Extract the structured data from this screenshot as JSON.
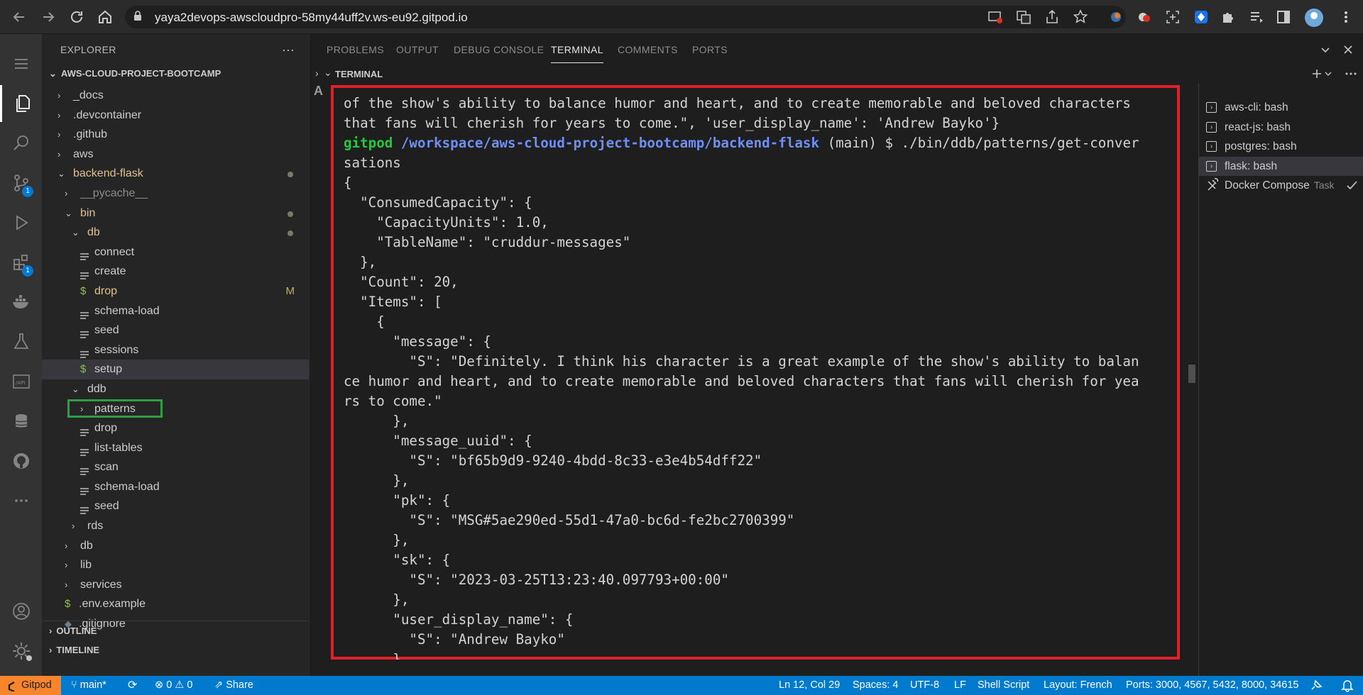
{
  "browser": {
    "url": "yaya2devops-awscloudpro-58my44uff2v.ws-eu92.gitpod.io"
  },
  "activity_bar": {
    "scm_badge": "1",
    "extensions_badge": "1"
  },
  "sidebar": {
    "title": "EXPLORER",
    "more": "···",
    "project": "AWS-CLOUD-PROJECT-BOOTCAMP",
    "items": [
      {
        "label": "_docs"
      },
      {
        "label": ".devcontainer"
      },
      {
        "label": ".github"
      },
      {
        "label": "aws"
      },
      {
        "label": "backend-flask"
      },
      {
        "label": "__pycache__"
      },
      {
        "label": "bin"
      },
      {
        "label": "db"
      },
      {
        "label": "connect"
      },
      {
        "label": "create"
      },
      {
        "label": "drop",
        "mark": "M"
      },
      {
        "label": "schema-load"
      },
      {
        "label": "seed"
      },
      {
        "label": "sessions"
      },
      {
        "label": "setup"
      },
      {
        "label": "ddb"
      },
      {
        "label": "patterns"
      },
      {
        "label": "drop"
      },
      {
        "label": "list-tables"
      },
      {
        "label": "scan"
      },
      {
        "label": "schema-load"
      },
      {
        "label": "seed"
      },
      {
        "label": "rds"
      },
      {
        "label": "db"
      },
      {
        "label": "lib"
      },
      {
        "label": "services"
      },
      {
        "label": ".env.example"
      },
      {
        "label": ".gitignore"
      }
    ],
    "outline": "OUTLINE",
    "timeline": "TIMELINE"
  },
  "panel": {
    "tabs": [
      "PROBLEMS",
      "OUTPUT",
      "DEBUG CONSOLE",
      "TERMINAL",
      "COMMENTS",
      "PORTS"
    ],
    "terminal_title": "TERMINAL",
    "terminal": {
      "line1": "of the show's ability to balance humor and heart, and to create memorable and beloved characters",
      "line2": "that fans will cherish for years to come.\", 'user_display_name': 'Andrew Bayko'}",
      "prompt_user": "gitpod",
      "prompt_path": "/workspace/aws-cloud-project-bootcamp/backend-flask",
      "prompt_cmd": " (main) $ ./bin/ddb/patterns/get-conver",
      "prompt_wrap": "sations",
      "body": "{\n  \"ConsumedCapacity\": {\n    \"CapacityUnits\": 1.0,\n    \"TableName\": \"cruddur-messages\"\n  },\n  \"Count\": 20,\n  \"Items\": [\n    {\n      \"message\": {\n        \"S\": \"Definitely. I think his character is a great example of the show's ability to balan\nce humor and heart, and to create memorable and beloved characters that fans will cherish for yea\nrs to come.\"\n      },\n      \"message_uuid\": {\n        \"S\": \"bf65b9d9-9240-4bdd-8c33-e3e4b54dff22\"\n      },\n      \"pk\": {\n        \"S\": \"MSG#5ae290ed-55d1-47a0-bc6d-fe2bc2700399\"\n      },\n      \"sk\": {\n        \"S\": \"2023-03-25T13:23:40.097793+00:00\"\n      },\n      \"user_display_name\": {\n        \"S\": \"Andrew Bayko\"\n      },"
    },
    "terminals": [
      {
        "label": "aws-cli: bash"
      },
      {
        "label": "react-js: bash"
      },
      {
        "label": "postgres: bash"
      },
      {
        "label": "flask: bash"
      },
      {
        "label": "Docker Compose",
        "task": "Task"
      }
    ]
  },
  "status_bar": {
    "gitpod": "Gitpod",
    "branch": "main*",
    "errors": "0",
    "warnings": "0",
    "share": "Share",
    "position": "Ln 12, Col 29",
    "spaces": "Spaces: 4",
    "encoding": "UTF-8",
    "eol": "LF",
    "language": "Shell Script",
    "layout": "Layout: French",
    "ports": "Ports: 3000, 4567, 5432, 8000, 34615"
  },
  "colors": {
    "highlight_red": "#e0212a",
    "highlight_green": "#2ea043",
    "status_blue": "#007acc",
    "gitpod_orange": "#f7852b"
  }
}
